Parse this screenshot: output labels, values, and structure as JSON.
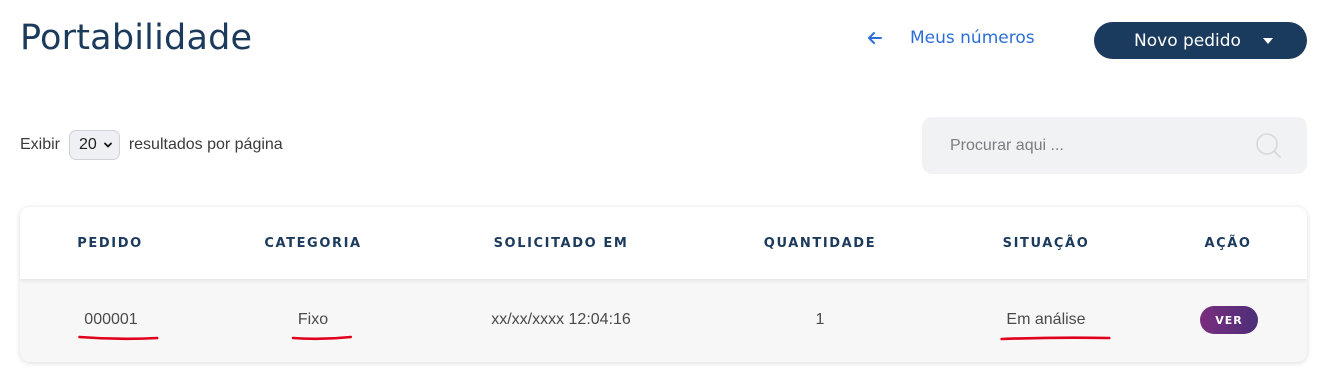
{
  "header": {
    "title": "Portabilidade",
    "back_link_label": "Meus números",
    "new_order_label": "Novo pedido"
  },
  "controls": {
    "show_label": "Exibir",
    "page_size_value": "20",
    "per_page_label": "resultados por página",
    "search_placeholder": "Procurar aqui ..."
  },
  "table": {
    "columns": [
      "PEDIDO",
      "CATEGORIA",
      "SOLICITADO EM",
      "QUANTIDADE",
      "SITUAÇÃO",
      "AÇÃO"
    ],
    "rows": [
      {
        "pedido": "000001",
        "categoria": "Fixo",
        "solicitado_em": "xx/xx/xxxx 12:04:16",
        "quantidade": "1",
        "situacao": "Em análise",
        "acao_label": "VER"
      }
    ]
  },
  "colors": {
    "primary": "#1a3a5e",
    "link": "#2b6fd6",
    "badge_start": "#7a2d7e",
    "badge_end": "#4c2f78",
    "annotation": "#e0001b"
  }
}
